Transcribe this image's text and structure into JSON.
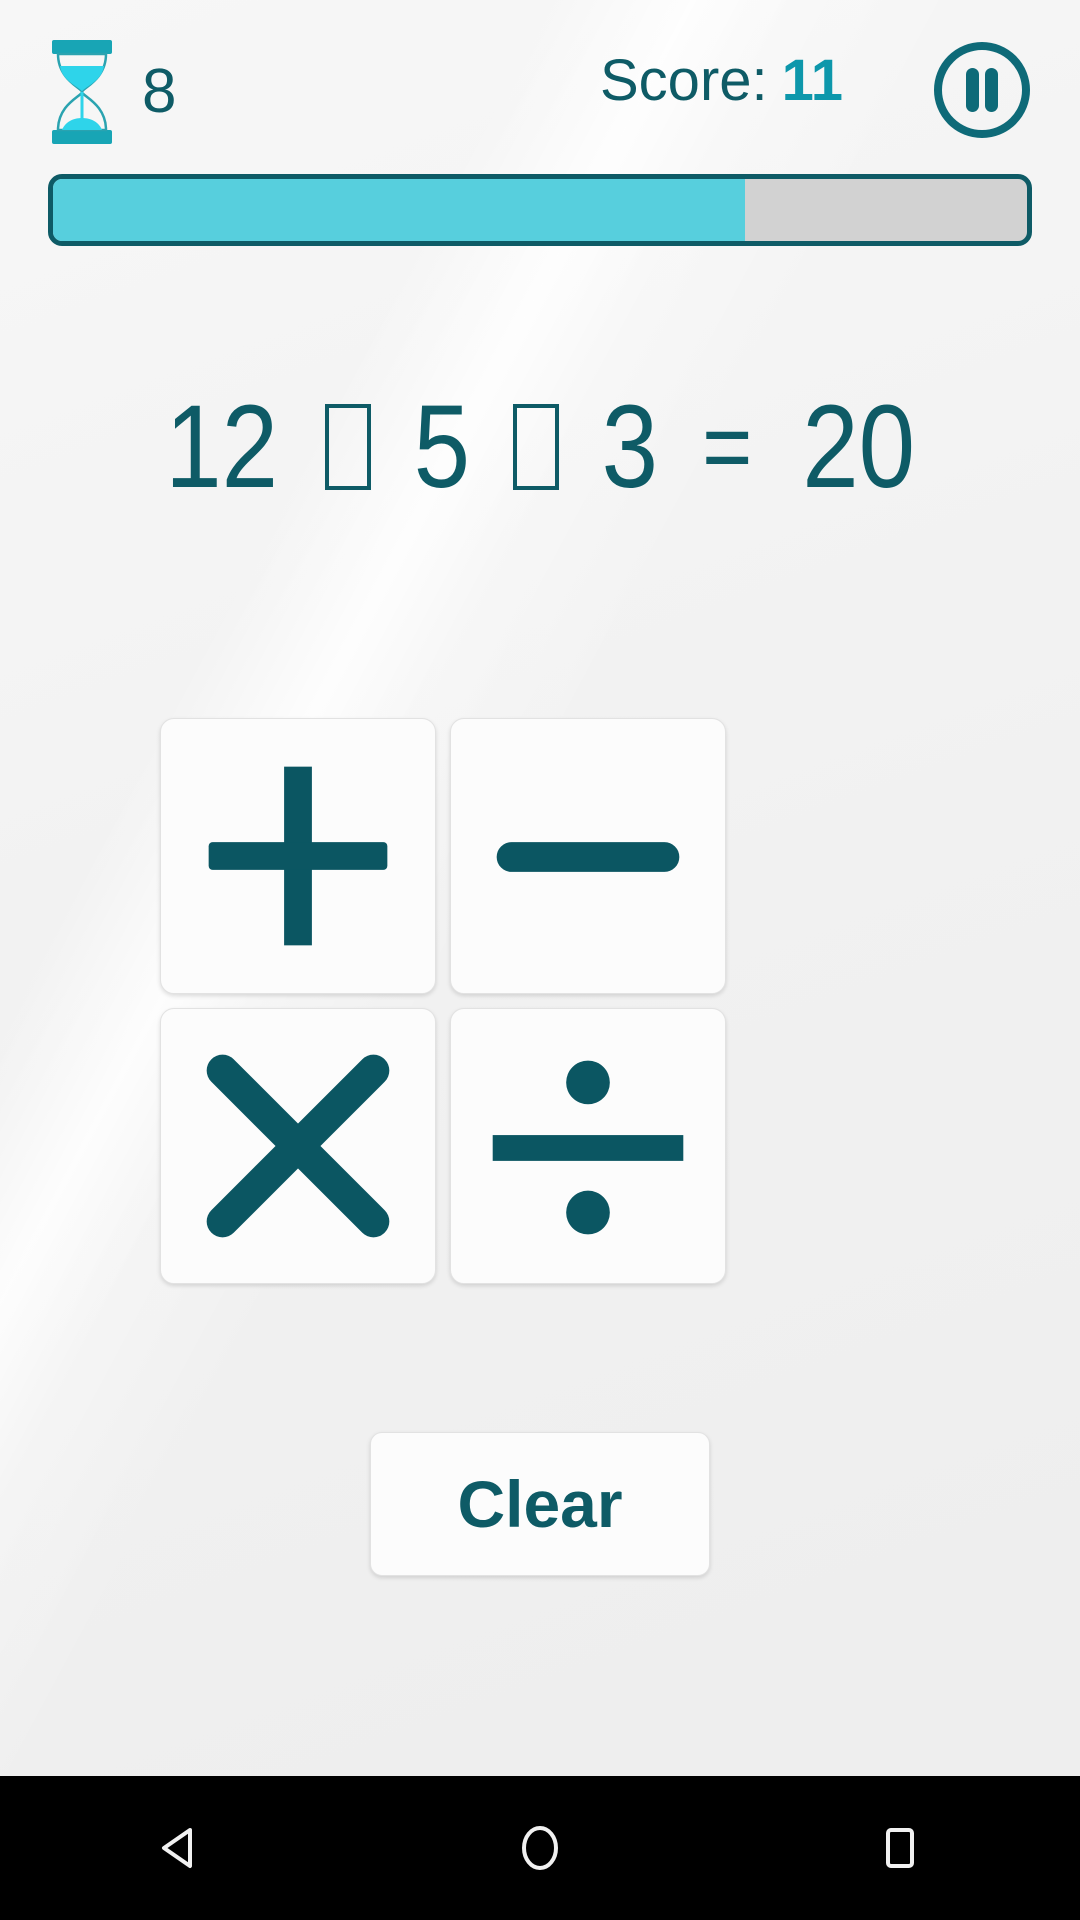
{
  "app": {
    "background_color": "#f2f2f2",
    "accent_dark": "#0e5b66",
    "accent_bright": "#0d97ab",
    "accent_cyan": "#57cfdd"
  },
  "header": {
    "timer_icon": "hourglass-icon",
    "timer_value": "8",
    "score_label": "Score:",
    "score_value": "11",
    "pause_icon": "pause-icon"
  },
  "progress": {
    "percent": 71,
    "fill_color": "#57cfdd",
    "track_color": "#d2d2d2",
    "border_color": "#0e5b66"
  },
  "equation": {
    "operand_1": "12",
    "slot_1": "",
    "operand_2": "5",
    "slot_2": "",
    "operand_3": "3",
    "equals": "=",
    "result": "20",
    "full_text": "12 □ 5 □ 3 = 20"
  },
  "operators": [
    {
      "name": "add",
      "symbol": "+",
      "icon": "plus-icon"
    },
    {
      "name": "subtract",
      "symbol": "−",
      "icon": "minus-icon"
    },
    {
      "name": "multiply",
      "symbol": "×",
      "icon": "multiply-icon"
    },
    {
      "name": "divide",
      "symbol": "÷",
      "icon": "divide-icon"
    }
  ],
  "clear": {
    "label": "Clear"
  },
  "navbar": {
    "back_icon": "back-triangle-icon",
    "home_icon": "home-circle-icon",
    "recents_icon": "recents-square-icon"
  }
}
